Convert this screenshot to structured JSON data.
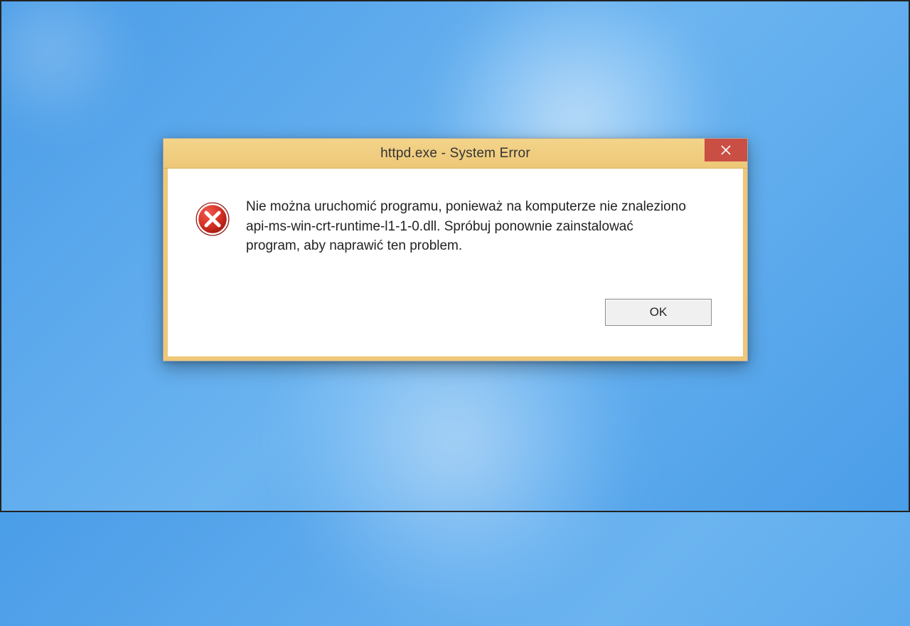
{
  "dialog": {
    "title": "httpd.exe - System Error",
    "message": "Nie można uruchomić programu, ponieważ na komputerze nie znaleziono api-ms-win-crt-runtime-l1-1-0.dll. Spróbuj ponownie zainstalować program, aby naprawić ten problem.",
    "ok_label": "OK",
    "close_glyph": "×",
    "icon": "error-icon"
  },
  "colors": {
    "titlebar": "#eec878",
    "close": "#c94f44",
    "background": "#4a9de8"
  }
}
